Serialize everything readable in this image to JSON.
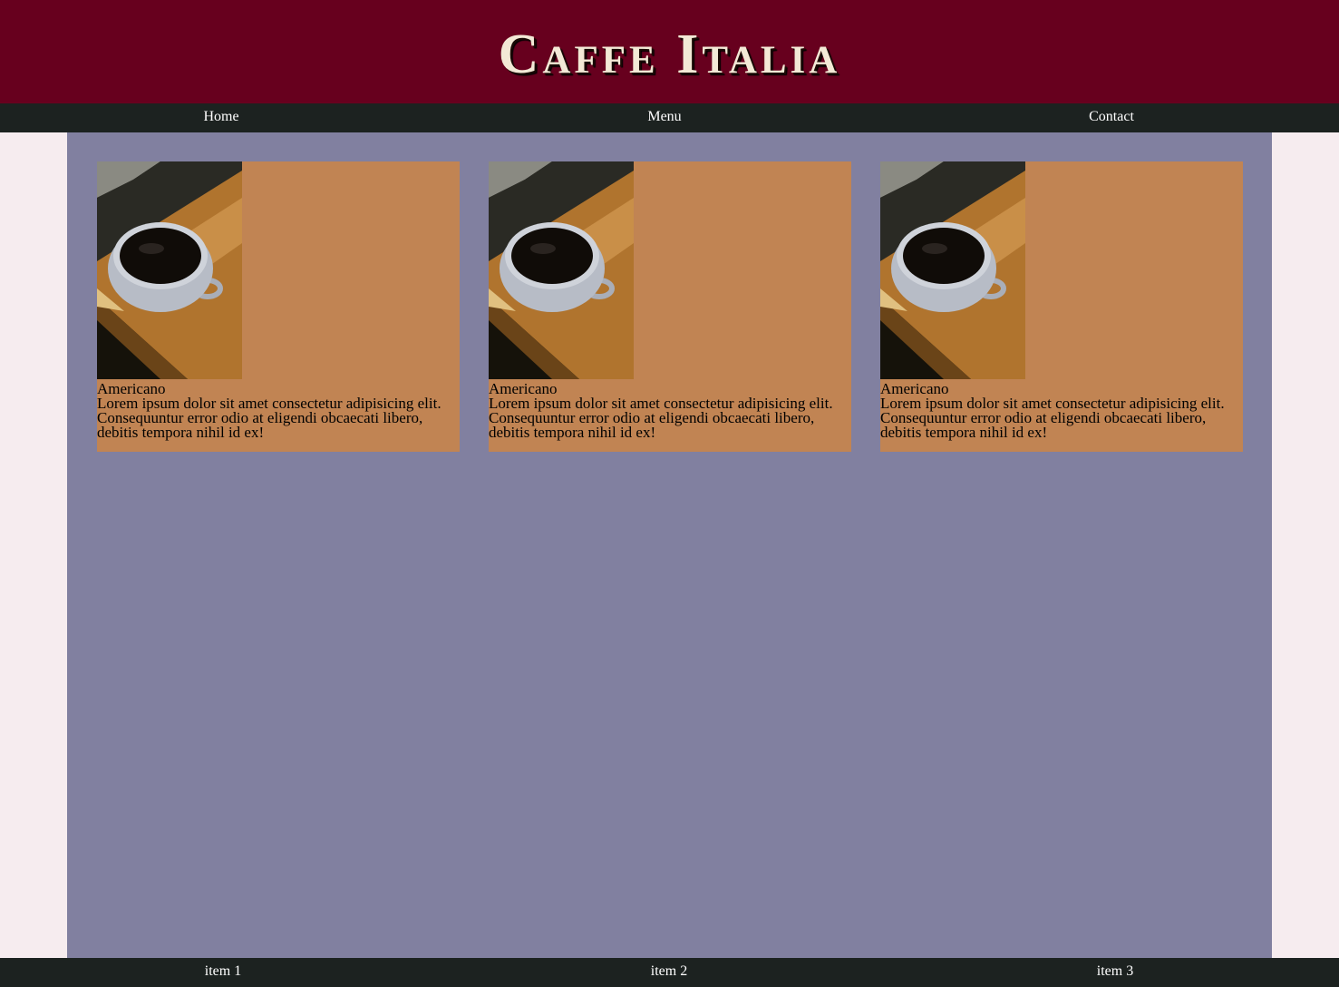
{
  "header": {
    "title": "Caffe Italia"
  },
  "nav": {
    "items": [
      {
        "label": "Home"
      },
      {
        "label": "Menu"
      },
      {
        "label": "Contact"
      }
    ]
  },
  "cards": [
    {
      "name": "Americano",
      "description": "Lorem ipsum dolor sit amet consectetur adipisicing elit. Consequuntur error odio at eligendi obcaecati libero, debitis tempora nihil id ex!"
    },
    {
      "name": "Americano",
      "description": "Lorem ipsum dolor sit amet consectetur adipisicing elit. Consequuntur error odio at eligendi obcaecati libero, debitis tempora nihil id ex!"
    },
    {
      "name": "Americano",
      "description": "Lorem ipsum dolor sit amet consectetur adipisicing elit. Consequuntur error odio at eligendi obcaecati libero, debitis tempora nihil id ex!"
    }
  ],
  "footer": {
    "items": [
      {
        "label": "item 1"
      },
      {
        "label": "item 2"
      },
      {
        "label": "item 3"
      }
    ]
  },
  "colors": {
    "header_bg": "#67001e",
    "nav_bg": "#1c2220",
    "main_bg": "#8180a0",
    "card_bg": "#c18453",
    "page_bg": "#f6ecef"
  }
}
